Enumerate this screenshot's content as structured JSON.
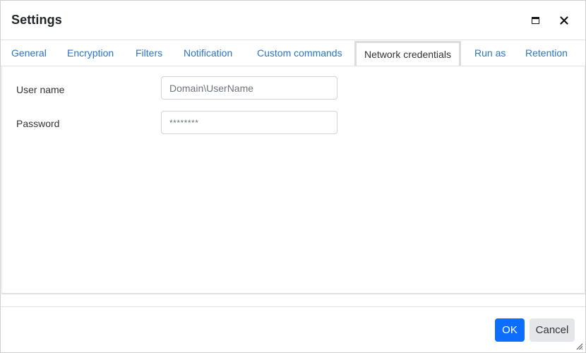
{
  "dialog": {
    "title": "Settings",
    "maximize_icon": "maximize-icon",
    "close_icon": "close-icon",
    "close_glyph": "✕"
  },
  "tabs": [
    {
      "label": "General",
      "active": false
    },
    {
      "label": "Encryption",
      "active": false
    },
    {
      "label": "Filters",
      "active": false
    },
    {
      "label": "Notification",
      "active": false
    },
    {
      "label": "Custom commands",
      "active": false
    },
    {
      "label": "Network credentials",
      "active": true
    },
    {
      "label": "Run as",
      "active": false
    },
    {
      "label": "Retention",
      "active": false
    }
  ],
  "form": {
    "username": {
      "label": "User name",
      "value": "",
      "placeholder": "Domain\\UserName"
    },
    "password": {
      "label": "Password",
      "value": "",
      "placeholder": "********"
    }
  },
  "footer": {
    "ok_label": "OK",
    "cancel_label": "Cancel"
  },
  "colors": {
    "accent": "#0d6efd",
    "tab_link": "#2a74c9",
    "cancel_bg": "#e4e6e9"
  }
}
